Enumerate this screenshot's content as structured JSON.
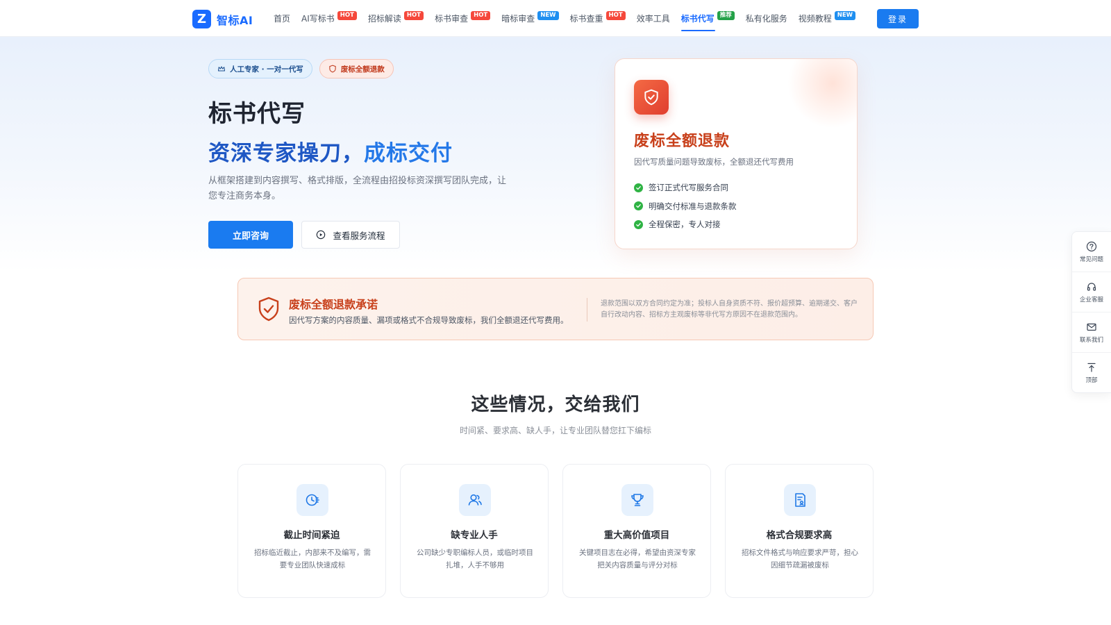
{
  "brand": {
    "logo_letter": "Z",
    "name": "智标AI",
    "color": "#1a6bff"
  },
  "nav": {
    "items": [
      {
        "label": "首页",
        "badge": ""
      },
      {
        "label": "AI写标书",
        "badge": "HOT"
      },
      {
        "label": "招标解读",
        "badge": "HOT"
      },
      {
        "label": "标书审查",
        "badge": "HOT"
      },
      {
        "label": "暗标审查",
        "badge": "NEW"
      },
      {
        "label": "标书查重",
        "badge": "HOT"
      },
      {
        "label": "效率工具",
        "badge": ""
      },
      {
        "label": "标书代写",
        "badge": "推荐",
        "active": true
      },
      {
        "label": "私有化服务",
        "badge": ""
      },
      {
        "label": "视频教程",
        "badge": "NEW"
      }
    ],
    "login_label": "登录"
  },
  "hero": {
    "tags": [
      "人工专家 · 一对一代写",
      "废标全额退款"
    ],
    "title": "标书代写",
    "subtitle_part1": "资深专家操刀，",
    "subtitle_part2": "成标交付",
    "description": "从框架搭建到内容撰写、格式排版，全流程由招投标资深撰写团队完成，让您专注商务本身。",
    "primary_button": "立即咨询",
    "secondary_button": "查看服务流程"
  },
  "refund_card": {
    "title": "废标全额退款",
    "description": "因代写质量问题导致废标，全额退还代写费用",
    "items": [
      "签订正式代写服务合同",
      "明确交付标准与退款条款",
      "全程保密，专人对接"
    ]
  },
  "promise": {
    "title": "废标全额退款承诺",
    "description": "因代写方案的内容质量、漏项或格式不合规导致废标，我们全额退还代写费用。",
    "note": "退款范围以双方合同约定为准；投标人自身资质不符、报价超预算、逾期递交、客户自行改动内容、招标方主观废标等非代写方原因不在退款范围内。"
  },
  "section": {
    "title": "这些情况，交给我们",
    "subtitle": "时间紧、要求高、缺人手，让专业团队替您扛下编标"
  },
  "cards": [
    {
      "icon": "clock-icon",
      "title": "截止时间紧迫",
      "description": "招标临近截止，内部来不及编写，需要专业团队快速成标"
    },
    {
      "icon": "users-icon",
      "title": "缺专业人手",
      "description": "公司缺少专职编标人员，或临时项目扎堆，人手不够用"
    },
    {
      "icon": "trophy-icon",
      "title": "重大高价值项目",
      "description": "关键项目志在必得，希望由资深专家把关内容质量与评分对标"
    },
    {
      "icon": "document-icon",
      "title": "格式合规要求高",
      "description": "招标文件格式与响应要求严苛，担心因细节疏漏被废标"
    }
  ],
  "floatbar": {
    "items": [
      {
        "icon": "question-icon",
        "label": "常见问题"
      },
      {
        "icon": "headset-icon",
        "label": "企业客服"
      },
      {
        "icon": "mail-icon",
        "label": "联系我们"
      },
      {
        "icon": "top-arrow-icon",
        "label": "顶部"
      }
    ]
  },
  "colors": {
    "primary": "#1a7bf0",
    "accent_red": "#c8401b",
    "hot_badge": "#f5483b",
    "new_badge": "#1f8ff0",
    "recommend_badge": "#24a148",
    "check_green": "#2fb344"
  }
}
